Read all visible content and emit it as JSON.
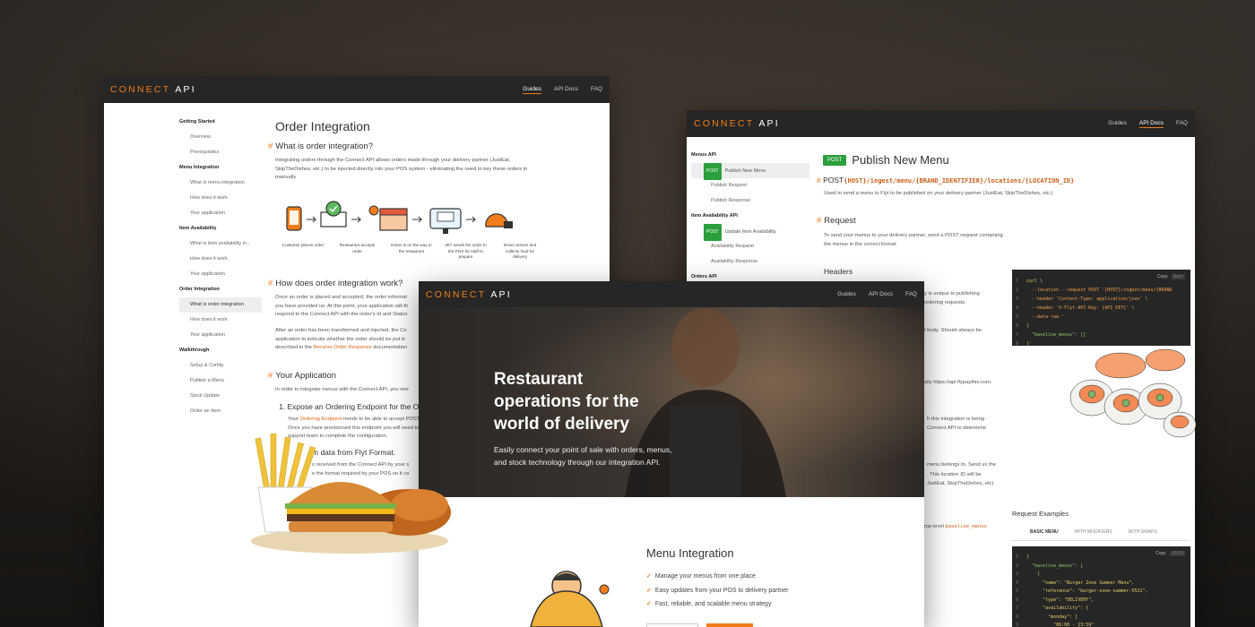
{
  "brand": {
    "connect": "CONNECT",
    "api": "API"
  },
  "nav": {
    "guides": "Guides",
    "api_docs": "API Docs",
    "faq": "FAQ"
  },
  "w1": {
    "sidebar": [
      {
        "label": "Getting Started",
        "type": "sec"
      },
      {
        "label": "Overview",
        "type": "it"
      },
      {
        "label": "Prerequisites",
        "type": "it"
      },
      {
        "label": "Menu Integration",
        "type": "sec"
      },
      {
        "label": "What is menu integration",
        "type": "it"
      },
      {
        "label": "How does it work",
        "type": "it"
      },
      {
        "label": "Your application",
        "type": "it"
      },
      {
        "label": "Item Availability",
        "type": "sec"
      },
      {
        "label": "What is item availability in...",
        "type": "it"
      },
      {
        "label": "How does it work",
        "type": "it"
      },
      {
        "label": "Your application",
        "type": "it"
      },
      {
        "label": "Order Integration",
        "type": "sec"
      },
      {
        "label": "What is order integration",
        "type": "it",
        "selected": true
      },
      {
        "label": "How does it work",
        "type": "it"
      },
      {
        "label": "Your application",
        "type": "it"
      },
      {
        "label": "Walkthrough",
        "type": "sec"
      },
      {
        "label": "Setup & Config",
        "type": "it"
      },
      {
        "label": "Publish a Menu",
        "type": "it"
      },
      {
        "label": "Stock Update",
        "type": "it"
      },
      {
        "label": "Order an Item",
        "type": "it"
      }
    ],
    "title": "Order Integration",
    "h_what": "What is order integration?",
    "p_what": "Integrating orders through the Connect API allows orders made through your delivery partner (JustEat, SkipTheDishes, etc.) to be injected directly into your POS system - eliminating the need to key these orders in manually",
    "steps": [
      {
        "label": "Customer places order",
        "icon": "phone-icon"
      },
      {
        "label": "Restaurant accepts order",
        "icon": "check-icon"
      },
      {
        "label": "Driver is on the way to the restaurant",
        "icon": "store-icon"
      },
      {
        "label": "JET sends the order to the POS for staff to prepare",
        "icon": "pos-icon"
      },
      {
        "label": "Driver arrives and collects food for delivery",
        "icon": "helmet-icon"
      }
    ],
    "h_how": "How does order integration work?",
    "p_how1a": "Once an order is placed and accepted, the order informat",
    "p_how1b": "you have provided us. At this point, your application will th",
    "p_how1c": "respond to the Connect API with the order's Id and Status",
    "p_how2a": "After an order has been transformed and injected, the Co",
    "p_how2b": "application to indicate whether the order should be put in",
    "p_how2c": "described in the",
    "p_how2_link": "Receive Order Response",
    "p_how2d": "documentation",
    "h_app": "Your Application",
    "p_app": "In order to integrate menus with the Connect API, you nee",
    "step1": "1. Expose an Ordering Endpoint for the O",
    "p_step1a": "Your",
    "p_step1_link": "Ordering Endpoint",
    "p_step1b": "needs to be able to accept POST",
    "p_step1c": "Once you have provisioned this endpoint you will need to",
    "p_step1d": "support team to complete the configuration.",
    "step2": "m data from Flyt Format.",
    "p_step2a": "s received from the Connect API by your s",
    "p_step2b": "e the format required by your POS so it ca"
  },
  "w2": {
    "sidebar": [
      {
        "label": "Menus API",
        "type": "sec"
      },
      {
        "label": "Publish New Menu",
        "type": "post",
        "selected": true
      },
      {
        "label": "Publish Request",
        "type": "it"
      },
      {
        "label": "Publish Response",
        "type": "it"
      },
      {
        "label": "Item Availability API",
        "type": "sec"
      },
      {
        "label": "Update Item Availability",
        "type": "post"
      },
      {
        "label": "Availability Request",
        "type": "it"
      },
      {
        "label": "Availability Response",
        "type": "it"
      },
      {
        "label": "Orders API",
        "type": "sec"
      }
    ],
    "post": "POST",
    "title": "Publish New Menu",
    "endpoint_method": "POST",
    "endpoint_path": "{HOST}/ingest/menu/{BRAND_IDENTIFIER}/locations/{LOCATION_ID}",
    "desc": "Used to send a menu to Flyt to be published on your delivery partner (JustEat, SkipTheDishes, etc.)",
    "h_request": "Request",
    "p_request": "To send your menus to your delivery partner, send a POST request containing the menus in the correct format.",
    "h_headers": "Headers",
    "frag1": "y is unique to publishing",
    "frag2": "ordering requests.",
    "frag3": "t body. Should always be",
    "frag4": "ally https://api.flypaythis.com.",
    "frag5": "h this integration is being",
    "frag6": "Connect API to determine",
    "frag7": "menu belongs to. Send us the",
    "frag8": ". This location ID will be",
    "frag9": "JustEat, SkipTheDishes, etc).",
    "frag10": "top-level",
    "frag10_code": "baseline_menus",
    "code1": {
      "copy": "Copy",
      "lang": "Bash",
      "lines": [
        "curl \\",
        "  --location --request POST '{HOST}/ingest/menu/{BRAND",
        "  --header 'Content-Type: application/json' \\",
        "  --header 'X-Flyt-API-Key: {API_KEY}' \\",
        "  --data-raw '",
        "{",
        "  \"baseline_menus\": []",
        "}'"
      ]
    },
    "examples_title": "Request Examples",
    "tabs": [
      "BASIC MENU",
      "WITH MODIFIERS",
      "WITH SWAPS"
    ],
    "code2": {
      "copy": "Copy",
      "lang": "JSON",
      "lines": [
        "{",
        "  \"baseline_menus\": [",
        "    {",
        "      \"name\": \"Burger Zone Summer Menu\",",
        "      \"reference\": \"burger-zone-summer-5521\",",
        "      \"type\": \"DELIVERY\",",
        "      \"availability\": {",
        "        \"monday\": [",
        "          \"06:00 - 23:59\""
      ]
    }
  },
  "w3": {
    "hero_title": "Restaurant operations for the world of delivery",
    "hero_sub": "Easily connect your point of sale with orders, menus, and stock technology through our integration API.",
    "section_title": "Menu Integration",
    "features": [
      "Manage your menus from one place",
      "Easy updates from your POS to delivery partner",
      "Fast, reliable, and scalable menu strategy"
    ]
  },
  "colors": {
    "accent": "#f07d1a",
    "post_green": "#2b9f3b",
    "nav_bg": "#262626"
  }
}
